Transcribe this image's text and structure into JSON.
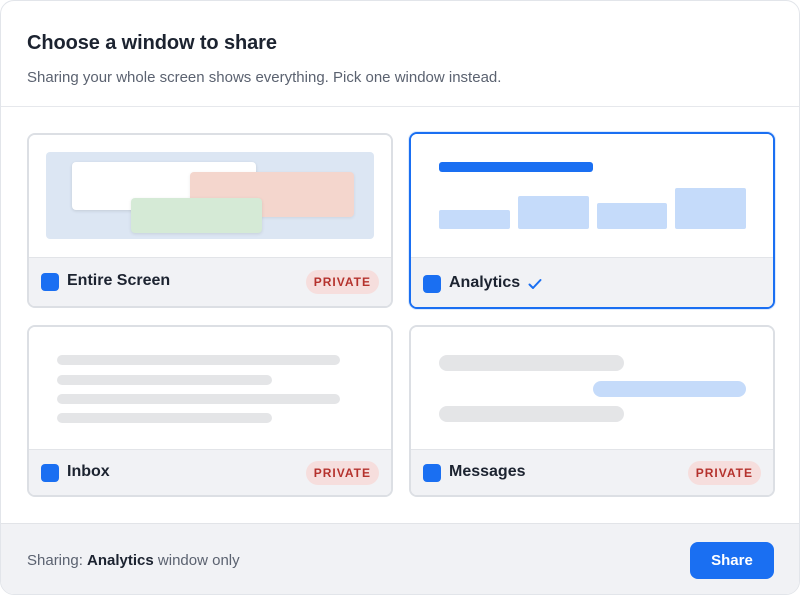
{
  "dialog": {
    "title": "Choose a window to share",
    "subtitle": "Sharing your whole screen shows everything. Pick one window instead."
  },
  "cards": [
    {
      "label": "Entire Screen",
      "badge": "PRIVATE",
      "selected": false
    },
    {
      "label": "Analytics",
      "badge": "",
      "selected": true,
      "icon": "checkmark-icon"
    },
    {
      "label": "Inbox",
      "badge": "PRIVATE",
      "selected": false
    },
    {
      "label": "Messages",
      "badge": "PRIVATE",
      "selected": false
    }
  ],
  "footer": {
    "status_prefix": "Sharing:",
    "status_window": "Analytics",
    "status_suffix": "window only",
    "share_label": "Share"
  },
  "colors": {
    "accent": "#1a6ff2",
    "private_badge_bg": "#f6dedd",
    "private_badge_text": "#b5322d"
  }
}
